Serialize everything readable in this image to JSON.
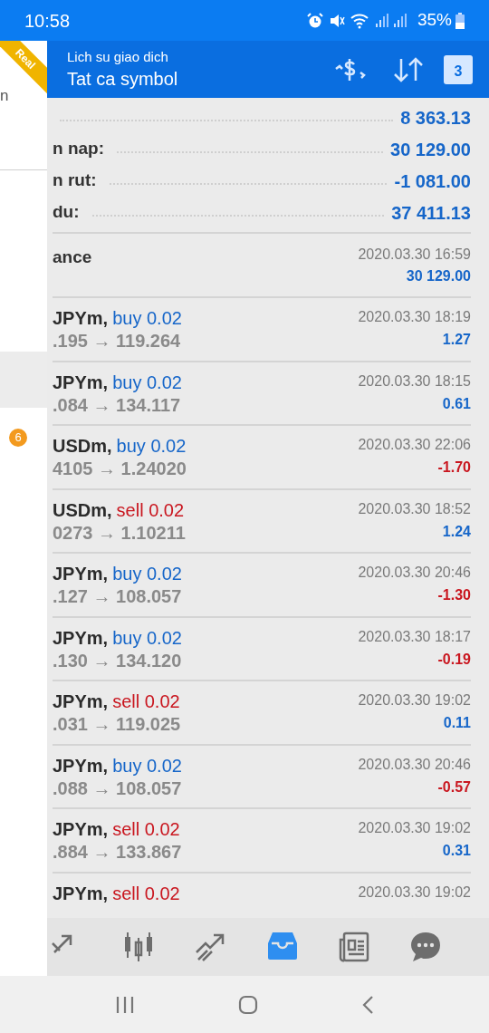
{
  "status_bar": {
    "time": "10:58",
    "battery": "35%"
  },
  "drawer": {
    "badge_ribbon": "Real",
    "item_text": "n",
    "counter": "6"
  },
  "app_bar": {
    "subtitle": "Lich su giao dich",
    "title": "Tat ca symbol",
    "calendar_day": "3"
  },
  "summary": [
    {
      "value": "8 363.13"
    },
    {
      "label": "n nap:",
      "value": "30 129.00"
    },
    {
      "label": "n rut:",
      "value": "-1 081.00"
    },
    {
      "label": "du:",
      "value": "37 411.13"
    }
  ],
  "deposit": {
    "label": "ance",
    "time": "2020.03.30 16:59",
    "amount": "30 129.00"
  },
  "trades": [
    {
      "symbol": "JPYm,",
      "side": "buy 0.02",
      "kind": "buy",
      "prices": ".195 → 119.264",
      "time": "2020.03.30 18:19",
      "profit": "1.27",
      "loss": false
    },
    {
      "symbol": "JPYm,",
      "side": "buy 0.02",
      "kind": "buy",
      "prices": ".084 → 134.117",
      "time": "2020.03.30 18:15",
      "profit": "0.61",
      "loss": false
    },
    {
      "symbol": "USDm,",
      "side": "buy 0.02",
      "kind": "buy",
      "prices": "4105 → 1.24020",
      "time": "2020.03.30 22:06",
      "profit": "-1.70",
      "loss": true
    },
    {
      "symbol": "USDm,",
      "side": "sell 0.02",
      "kind": "sell",
      "prices": "0273 → 1.10211",
      "time": "2020.03.30 18:52",
      "profit": "1.24",
      "loss": false
    },
    {
      "symbol": "JPYm,",
      "side": "buy 0.02",
      "kind": "buy",
      "prices": ".127 → 108.057",
      "time": "2020.03.30 20:46",
      "profit": "-1.30",
      "loss": true
    },
    {
      "symbol": "JPYm,",
      "side": "buy 0.02",
      "kind": "buy",
      "prices": ".130 → 134.120",
      "time": "2020.03.30 18:17",
      "profit": "-0.19",
      "loss": true
    },
    {
      "symbol": "JPYm,",
      "side": "sell 0.02",
      "kind": "sell",
      "prices": ".031 → 119.025",
      "time": "2020.03.30 19:02",
      "profit": "0.11",
      "loss": false
    },
    {
      "symbol": "JPYm,",
      "side": "buy 0.02",
      "kind": "buy",
      "prices": ".088 → 108.057",
      "time": "2020.03.30 20:46",
      "profit": "-0.57",
      "loss": true
    },
    {
      "symbol": "JPYm,",
      "side": "sell 0.02",
      "kind": "sell",
      "prices": ".884 → 133.867",
      "time": "2020.03.30 19:02",
      "profit": "0.31",
      "loss": false
    },
    {
      "symbol": "JPYm,",
      "side": "sell 0.02",
      "kind": "sell",
      "time": "2020.03.30 19:02"
    }
  ],
  "bottom_nav": [
    {
      "kind": "trade",
      "selected": false
    },
    {
      "kind": "chart",
      "selected": false
    },
    {
      "kind": "trend",
      "selected": false
    },
    {
      "kind": "history",
      "selected": true
    },
    {
      "kind": "news",
      "selected": false
    },
    {
      "kind": "chat",
      "selected": false
    }
  ]
}
